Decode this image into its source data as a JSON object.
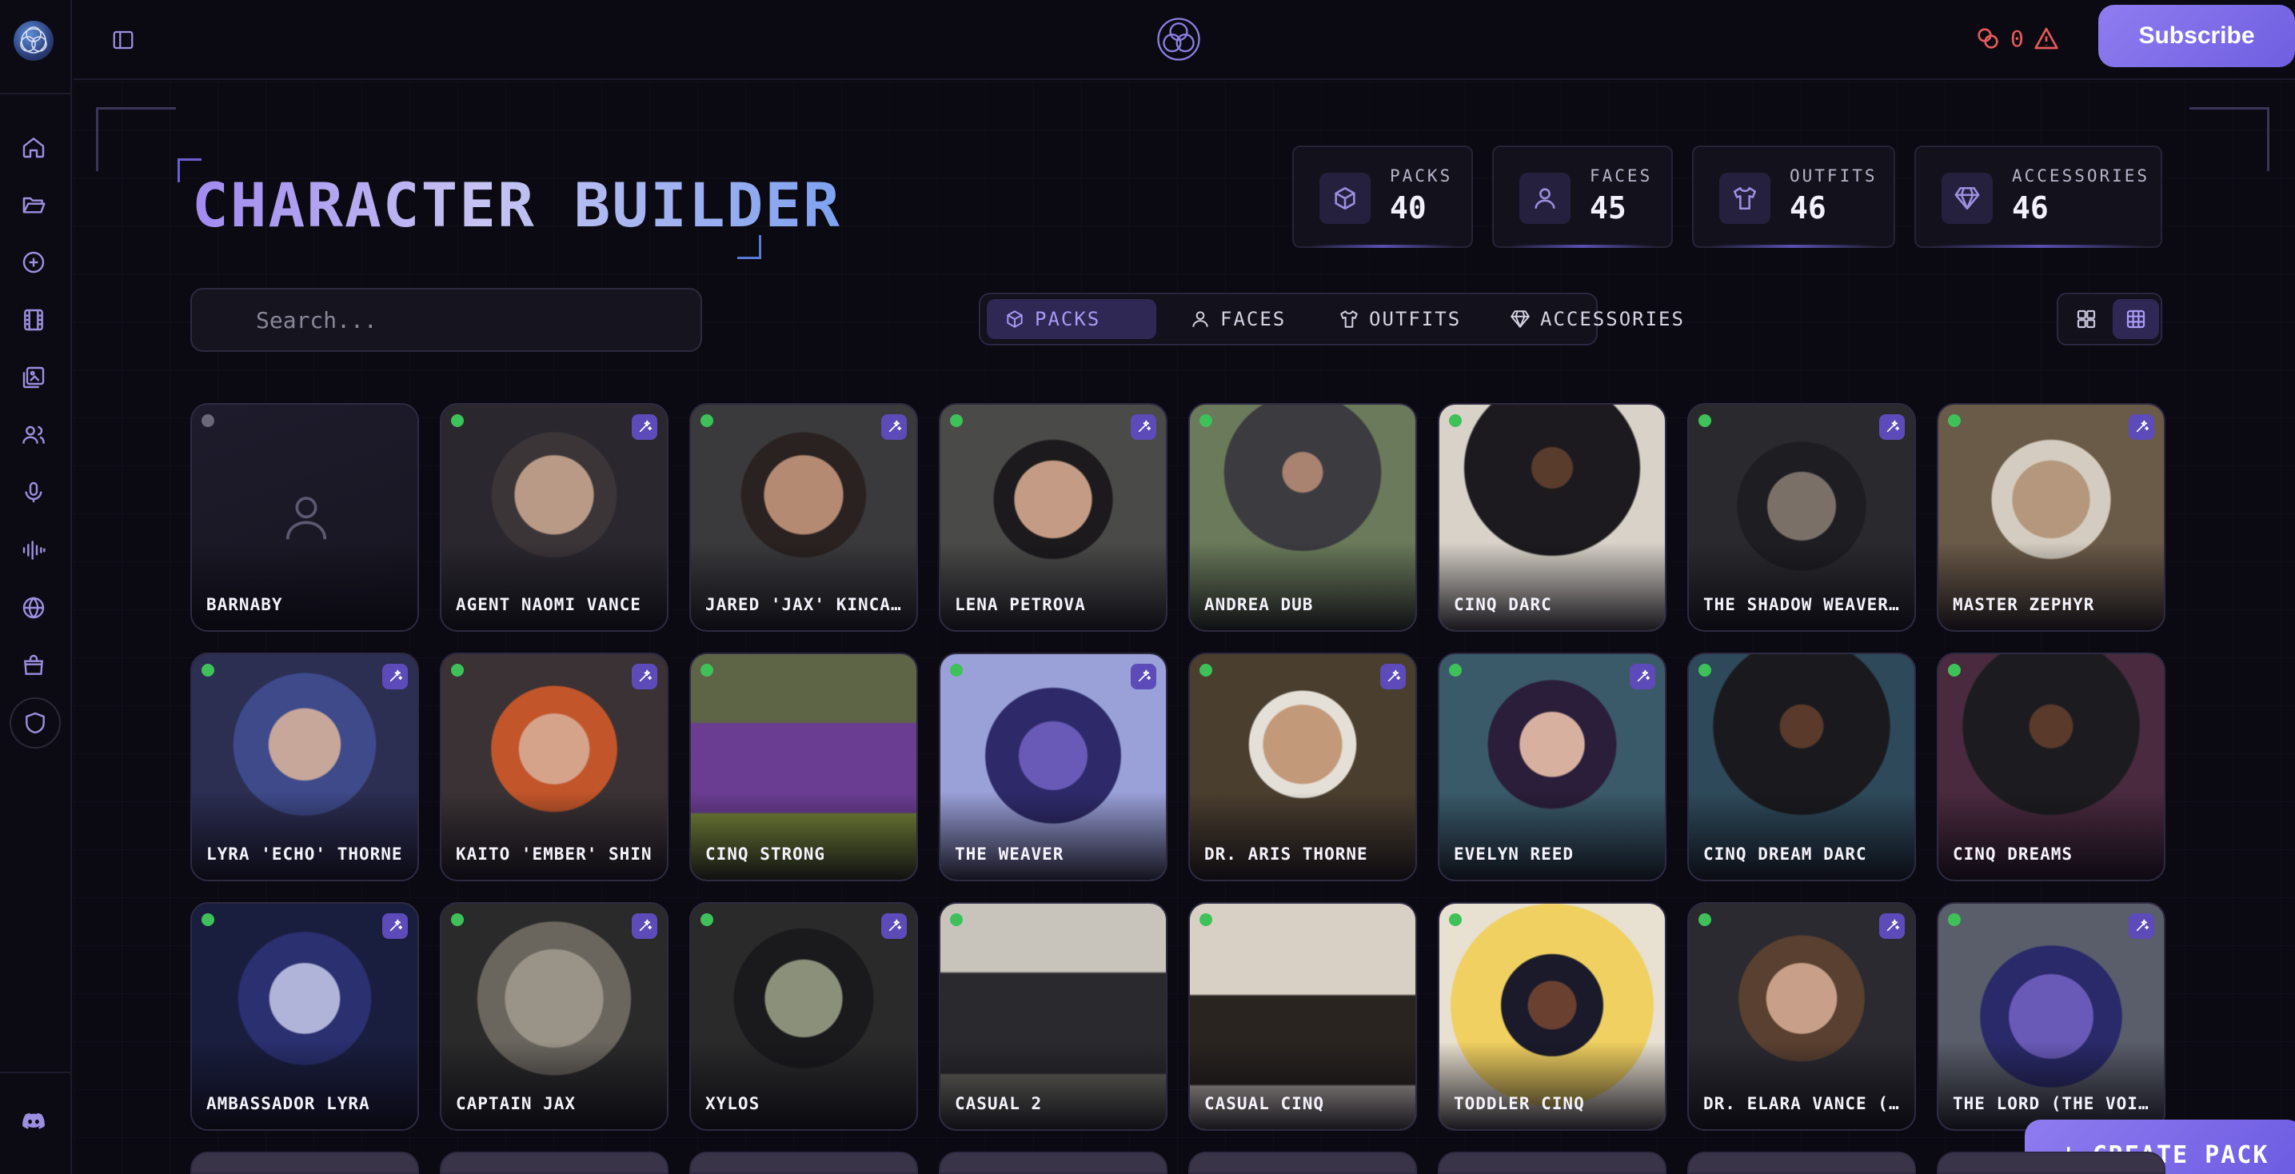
{
  "topbar": {
    "credits_count": "0",
    "subscribe_label": "Subscribe"
  },
  "page": {
    "title": "CHARACTER BUILDER"
  },
  "stats": [
    {
      "label": "PACKS",
      "value": "40",
      "icon": "cube-icon"
    },
    {
      "label": "FACES",
      "value": "45",
      "icon": "user-icon"
    },
    {
      "label": "OUTFITS",
      "value": "46",
      "icon": "shirt-icon"
    },
    {
      "label": "ACCESSORIES",
      "value": "46",
      "icon": "gem-icon"
    }
  ],
  "search": {
    "placeholder": "Search..."
  },
  "tabs": [
    {
      "label": "PACKS",
      "active": true
    },
    {
      "label": "FACES",
      "active": false
    },
    {
      "label": "OUTFITS",
      "active": false
    },
    {
      "label": "ACCESSORIES",
      "active": false
    }
  ],
  "characters": [
    {
      "name": "BARNABY",
      "online": false,
      "enhanced": false
    },
    {
      "name": "AGENT NAOMI VANCE",
      "online": true,
      "enhanced": true
    },
    {
      "name": "JARED 'JAX' KINCAID",
      "online": true,
      "enhanced": true
    },
    {
      "name": "LENA PETROVA",
      "online": true,
      "enhanced": true
    },
    {
      "name": "ANDREA DUB",
      "online": true,
      "enhanced": false
    },
    {
      "name": "CINQ DARC",
      "online": true,
      "enhanced": false
    },
    {
      "name": "THE SHADOW WEAVER (...",
      "online": true,
      "enhanced": true
    },
    {
      "name": "MASTER ZEPHYR",
      "online": true,
      "enhanced": true
    },
    {
      "name": "LYRA 'ECHO' THORNE",
      "online": true,
      "enhanced": true
    },
    {
      "name": "KAITO 'EMBER' SHIN",
      "online": true,
      "enhanced": true
    },
    {
      "name": "CINQ STRONG",
      "online": true,
      "enhanced": false
    },
    {
      "name": "THE WEAVER",
      "online": true,
      "enhanced": true
    },
    {
      "name": "DR. ARIS THORNE",
      "online": true,
      "enhanced": true
    },
    {
      "name": "EVELYN REED",
      "online": true,
      "enhanced": true
    },
    {
      "name": "CINQ DREAM DARC",
      "online": true,
      "enhanced": false
    },
    {
      "name": "CINQ DREAMS",
      "online": true,
      "enhanced": false
    },
    {
      "name": "AMBASSADOR LYRA",
      "online": true,
      "enhanced": true
    },
    {
      "name": "CAPTAIN JAX",
      "online": true,
      "enhanced": true
    },
    {
      "name": "XYLOS",
      "online": true,
      "enhanced": true
    },
    {
      "name": "CASUAL 2",
      "online": true,
      "enhanced": false
    },
    {
      "name": "CASUAL CINQ",
      "online": true,
      "enhanced": false
    },
    {
      "name": "TODDLER CINQ",
      "online": true,
      "enhanced": false
    },
    {
      "name": "DR. ELARA VANCE (AR...",
      "online": true,
      "enhanced": true
    },
    {
      "name": "THE LORD (THE VOID...",
      "online": true,
      "enhanced": true
    }
  ],
  "create_pack_label": "CREATE PACK",
  "colors": {
    "accent": "#8f7cf0",
    "background": "#0b0a12",
    "online": "#3fc15a",
    "alert": "#e55b5b"
  }
}
